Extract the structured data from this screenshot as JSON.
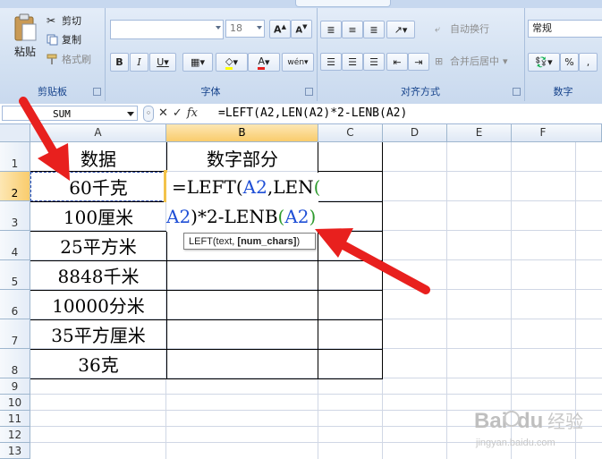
{
  "ribbon": {
    "clipboard": {
      "paste_label": "粘贴",
      "cut_label": "剪切",
      "copy_label": "复制",
      "format_painter_label": "格式刷",
      "group_label": "剪贴板"
    },
    "font": {
      "font_name": "",
      "font_size": "18",
      "bold": "B",
      "italic": "I",
      "underline": "U",
      "phonetic": "wén",
      "group_label": "字体"
    },
    "alignment": {
      "wrap_label": "自动换行",
      "merge_label": "合并后居中",
      "group_label": "对齐方式"
    },
    "number": {
      "format_value": "常规",
      "percent": "%",
      "comma": ",",
      "group_label": "数字"
    }
  },
  "formula_bar": {
    "name_box": "SUM",
    "cancel_icon": "✕",
    "enter_icon": "✓",
    "fx_label": "fx",
    "formula": "=LEFT(A2,LEN(A2)*2-LENB(A2)"
  },
  "grid": {
    "columns": [
      "A",
      "B",
      "C",
      "D",
      "E",
      "F"
    ],
    "rows": [
      "1",
      "2",
      "3",
      "4",
      "5",
      "6",
      "7",
      "8",
      "9",
      "10",
      "11",
      "12",
      "13"
    ],
    "header_a1": "数据",
    "header_b1": "数字部分",
    "data": [
      "60千克",
      "100厘米",
      "25平方米",
      "8848千米",
      "10000分米",
      "35平方厘米",
      "36克"
    ],
    "edit_formula_parts": {
      "line1_prefix": "=LEFT(",
      "line1_ref": "A2",
      "line1_mid": ",LEN",
      "line1_paren": "(",
      "line2_ref1": "A2",
      "line2_mid": ")*2-LENB",
      "line2_open": "(",
      "line2_ref2": "A2",
      "line2_close": ")"
    },
    "tooltip": {
      "fn": "LEFT(text, ",
      "arg": "[num_chars]",
      "tail": ")"
    }
  },
  "colors": {
    "accent_arrow": "#e8201e",
    "ref_blue": "#1f4fd6",
    "ref_green": "#2d9a2d",
    "selected_header": "#f9cc6c"
  },
  "watermark": {
    "brand": "Bai",
    "brand2": "du",
    "cn": "经验",
    "url": "jingyan.baidu.com"
  }
}
